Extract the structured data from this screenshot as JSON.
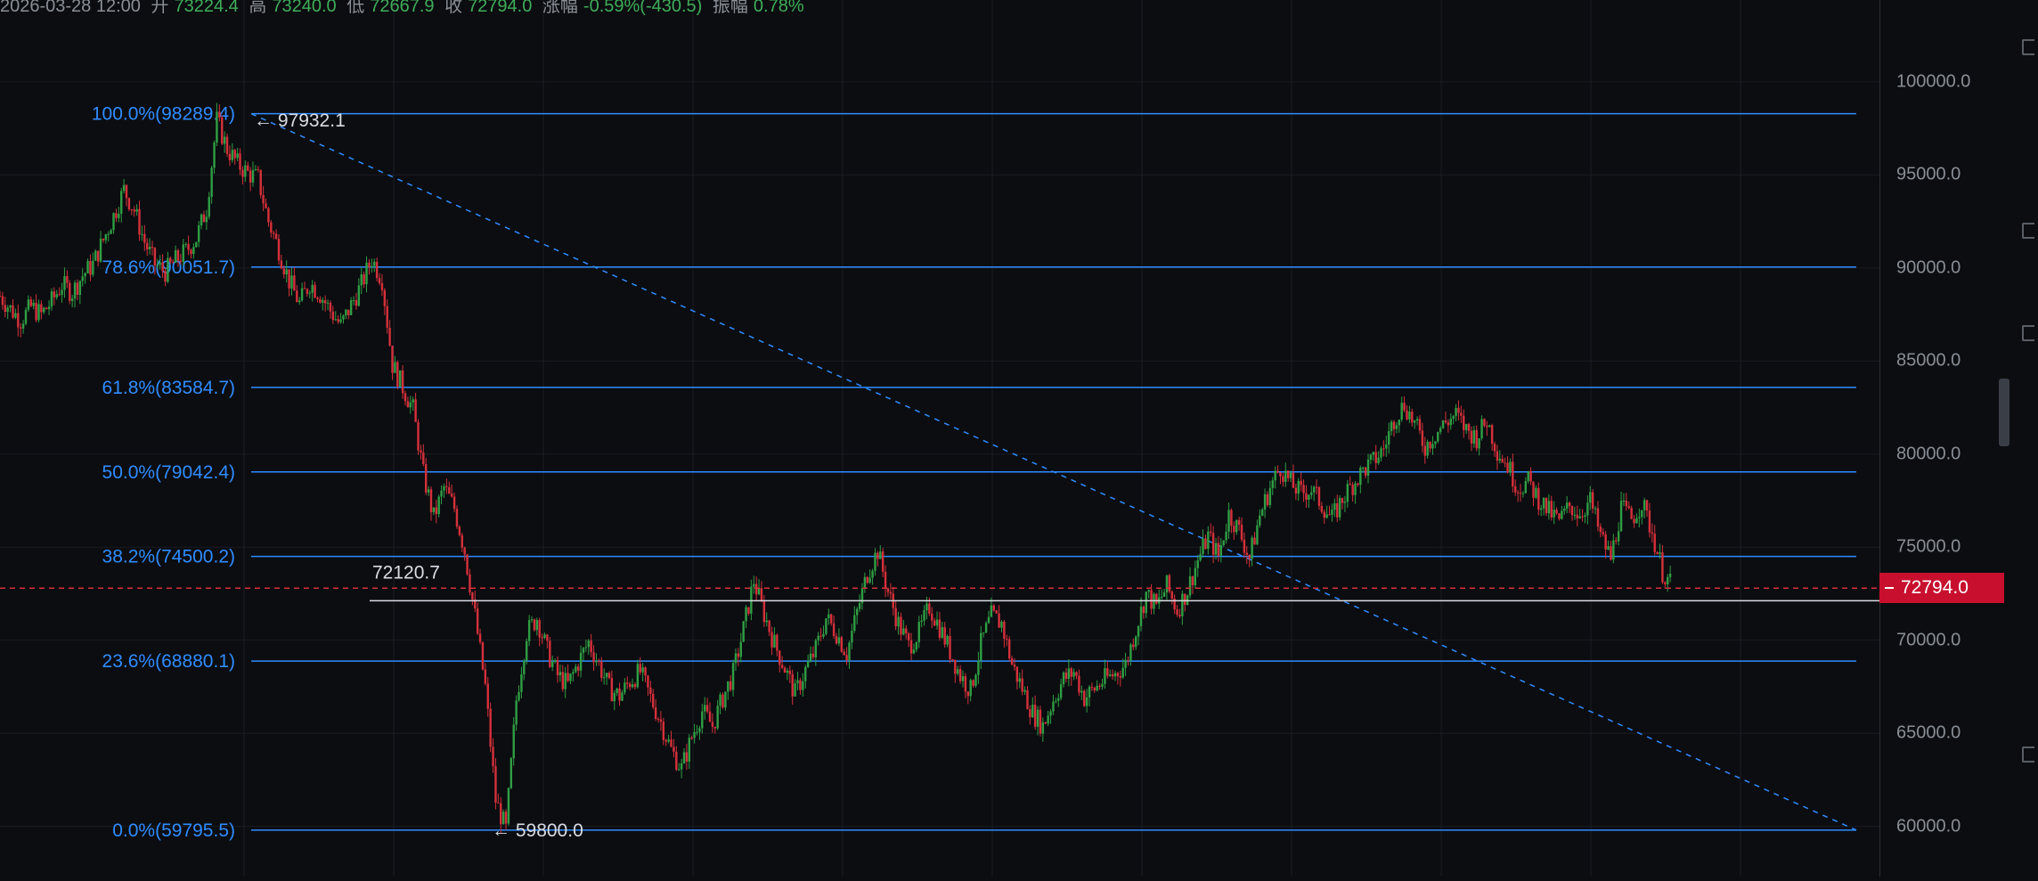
{
  "info_bar": {
    "date": "2026-03-28 12:00",
    "open_label": "开",
    "open": "73224.4",
    "high_label": "高",
    "high": "73240.0",
    "low_label": "低",
    "low": "72667.9",
    "close_label": "收",
    "close": "72794.0",
    "change_label": "涨幅",
    "change": "-0.59%(-430.5)",
    "amplitude_label": "振幅",
    "amplitude": "0.78%"
  },
  "price_axis": {
    "ticks": [
      "100000.0",
      "95000.0",
      "90000.0",
      "85000.0",
      "80000.0",
      "75000.0",
      "70000.0",
      "65000.0",
      "60000.0"
    ]
  },
  "last_price": "72794.0",
  "colors": {
    "background": "#0b0d10",
    "fib_line": "#2f8cff",
    "fib_text": "#2f8cff",
    "candle_up": "#2f9e44",
    "candle_down": "#d6303b",
    "last_price_bg": "#c8102e",
    "grid": "#1a1d22",
    "trendline": "#2f8cff",
    "horizontal_line": "#d9dde3"
  },
  "chart_data": {
    "type": "candlestick",
    "ylim": [
      57300,
      104400
    ],
    "y_ticks": [
      60000,
      65000,
      70000,
      75000,
      80000,
      85000,
      90000,
      95000,
      100000
    ],
    "grid": true,
    "fibonacci_levels": [
      {
        "label": "100.0%(98289.4)",
        "value": 98289.4
      },
      {
        "label": "78.6%(90051.7)",
        "value": 90051.7
      },
      {
        "label": "61.8%(83584.7)",
        "value": 83584.7
      },
      {
        "label": "50.0%(79042.4)",
        "value": 79042.4
      },
      {
        "label": "38.2%(74500.2)",
        "value": 74500.2
      },
      {
        "label": "23.6%(68880.1)",
        "value": 68880.1
      },
      {
        "label": "0.0%(59795.5)",
        "value": 59795.5
      }
    ],
    "annotations": [
      {
        "text": "97932.1",
        "value": 97932.1,
        "kind": "high-marker"
      },
      {
        "text": "59800.0",
        "value": 59800.0,
        "kind": "low-marker"
      },
      {
        "text": "72120.7",
        "value": 72120.7,
        "kind": "horizontal-line"
      }
    ],
    "trendline": {
      "from": 98289.4,
      "to": 59795.5,
      "style": "dashed"
    },
    "last_price": 72794.0,
    "close_path": [
      88500,
      87800,
      87200,
      87900,
      87500,
      88200,
      89100,
      88700,
      89600,
      90200,
      91500,
      92800,
      94200,
      93100,
      91400,
      90200,
      89800,
      90400,
      90900,
      91600,
      93200,
      97932,
      96400,
      95600,
      95100,
      94800,
      92500,
      91000,
      89300,
      88100,
      89200,
      88600,
      87700,
      86900,
      88000,
      89100,
      90500,
      89400,
      84800,
      83600,
      82400,
      78900,
      76600,
      78200,
      77100,
      74800,
      71300,
      67500,
      61400,
      59800,
      66800,
      70400,
      71200,
      69400,
      68100,
      67600,
      68800,
      69900,
      68700,
      67400,
      67000,
      67800,
      68300,
      66900,
      65600,
      64100,
      63100,
      64800,
      66200,
      65400,
      66900,
      68200,
      70600,
      73200,
      71400,
      69800,
      68500,
      67100,
      68400,
      69500,
      71200,
      70400,
      69300,
      71500,
      73600,
      74800,
      72600,
      70900,
      69700,
      70400,
      71800,
      70700,
      69400,
      68100,
      67300,
      69800,
      71300,
      70900,
      68700,
      67400,
      66100,
      65400,
      66800,
      67900,
      68300,
      66900,
      67400,
      67900,
      68200,
      68700,
      70600,
      72500,
      71800,
      72900,
      71600,
      72700,
      74300,
      75600,
      74500,
      76800,
      75900,
      74400,
      76700,
      78200,
      79300,
      78400,
      77900,
      78100,
      77300,
      76500,
      77600,
      78400,
      79100,
      79600,
      80300,
      81900,
      82700,
      81600,
      80400,
      81100,
      81700,
      82100,
      81300,
      80900,
      81800,
      80200,
      79400,
      78200,
      78500,
      77600,
      76900,
      76400,
      77200,
      76800,
      77500,
      75600,
      74400,
      77100,
      76500,
      77400,
      75800,
      73700,
      72794
    ]
  }
}
